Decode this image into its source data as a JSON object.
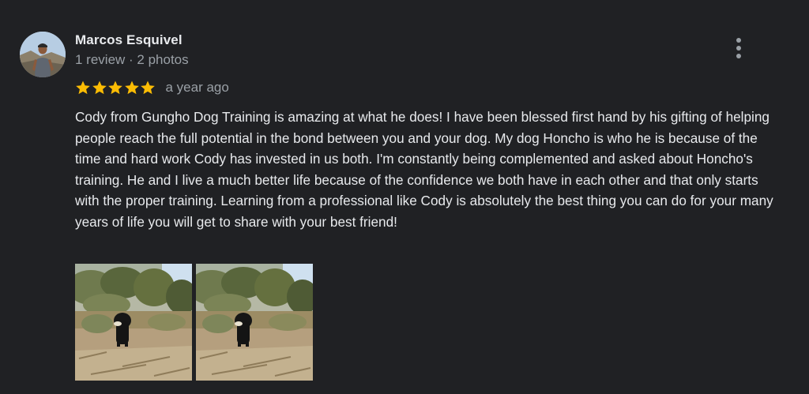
{
  "review": {
    "author": {
      "name": "Marcos Esquivel",
      "meta": "1 review · 2 photos"
    },
    "rating": 5,
    "rating_max": 5,
    "time_ago": "a year ago",
    "text": "Cody from Gungho Dog Training is amazing at what he does! I have been blessed first hand by his gifting of helping people reach the full potential in the bond between you and your dog. My dog Honcho is who he is because of the time and hard work Cody has invested in us both. I'm constantly being complemented and asked about Honcho's training. He and I live a much better life because of the confidence we both have in each other and that only starts with the proper training. Learning from a professional like Cody is absolutely the best thing you can do for your many years of life you will get to share with your best friend!",
    "photo_count": 2
  },
  "icons": {
    "more": "more-vert-icon",
    "star": "star-icon"
  },
  "colors": {
    "background": "#202124",
    "star": "#fbbc04",
    "primary_text": "#e8eaed",
    "secondary_text": "#9aa0a6"
  }
}
